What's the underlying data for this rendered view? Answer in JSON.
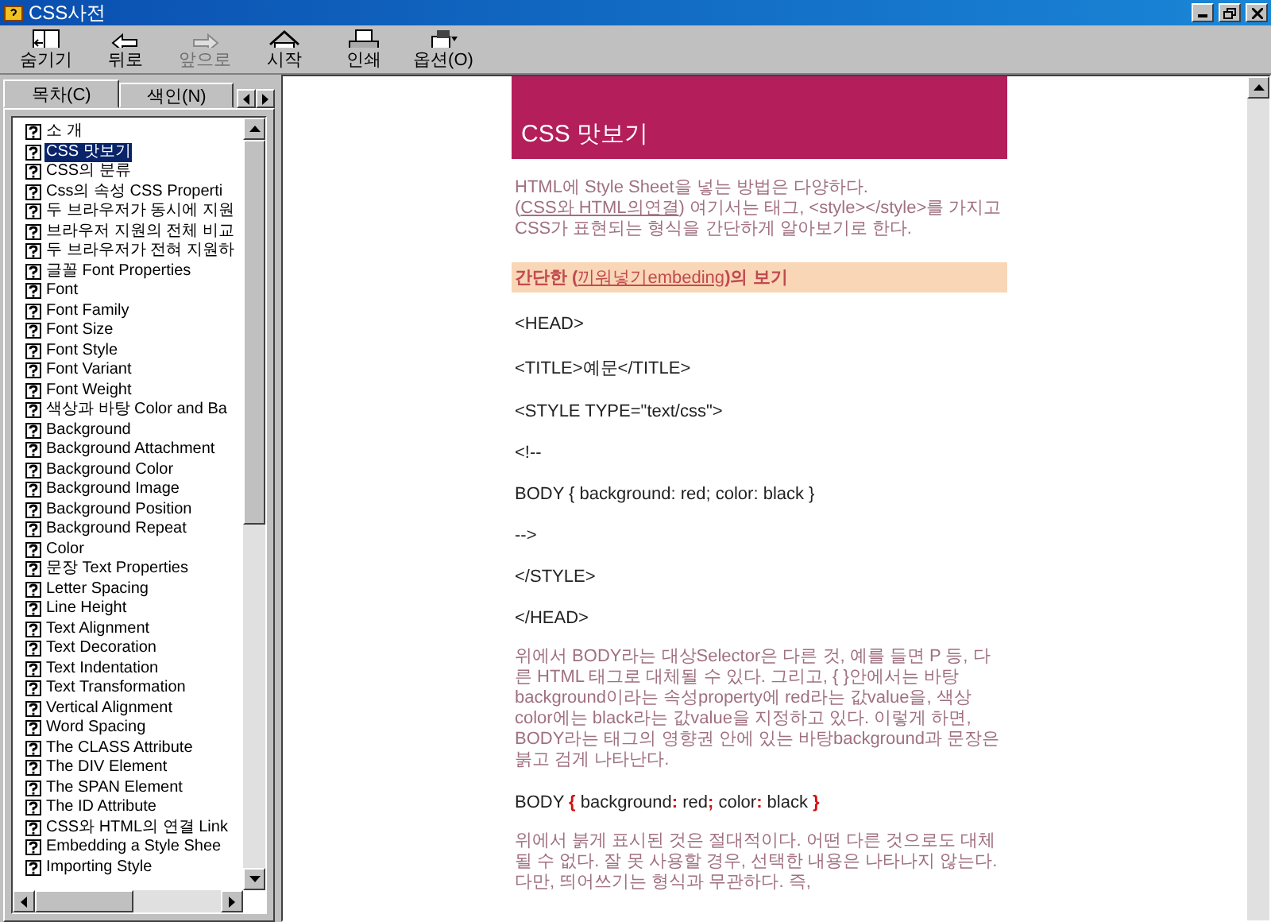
{
  "window": {
    "title": "CSS사전"
  },
  "toolbar": [
    {
      "label": "숨기기",
      "kind": "hide",
      "disabled": false
    },
    {
      "label": "뒤로",
      "kind": "back",
      "disabled": false
    },
    {
      "label": "앞으로",
      "kind": "forward",
      "disabled": true
    },
    {
      "label": "시작",
      "kind": "home",
      "disabled": false
    },
    {
      "label": "인쇄",
      "kind": "print",
      "disabled": false
    },
    {
      "label": "옵션(O)",
      "kind": "options",
      "disabled": false
    }
  ],
  "tabs": [
    {
      "label": "목차(C)",
      "selected": true
    },
    {
      "label": "색인(N)",
      "selected": false
    }
  ],
  "contents": [
    {
      "label": "소 개",
      "selected": false
    },
    {
      "label": "CSS 맛보기",
      "selected": true
    },
    {
      "label": "CSS의 분류",
      "selected": false
    },
    {
      "label": "Css의 속성 CSS Properti",
      "selected": false
    },
    {
      "label": "두 브라우저가 동시에 지원",
      "selected": false
    },
    {
      "label": "브라우저 지원의 전체 비교",
      "selected": false
    },
    {
      "label": "두 브라우저가 전혀 지원하",
      "selected": false
    },
    {
      "label": "글꼴 Font Properties",
      "selected": false
    },
    {
      "label": "Font",
      "selected": false
    },
    {
      "label": "Font Family",
      "selected": false
    },
    {
      "label": "Font Size",
      "selected": false
    },
    {
      "label": "Font Style",
      "selected": false
    },
    {
      "label": "Font Variant",
      "selected": false
    },
    {
      "label": "Font Weight",
      "selected": false
    },
    {
      "label": "색상과 바탕 Color and Ba",
      "selected": false
    },
    {
      "label": "Background",
      "selected": false
    },
    {
      "label": "Background Attachment",
      "selected": false
    },
    {
      "label": "Background Color",
      "selected": false
    },
    {
      "label": "Background Image",
      "selected": false
    },
    {
      "label": "Background Position",
      "selected": false
    },
    {
      "label": "Background Repeat",
      "selected": false
    },
    {
      "label": "Color",
      "selected": false
    },
    {
      "label": "문장 Text Properties",
      "selected": false
    },
    {
      "label": "Letter Spacing",
      "selected": false
    },
    {
      "label": "Line Height",
      "selected": false
    },
    {
      "label": "Text Alignment",
      "selected": false
    },
    {
      "label": "Text Decoration",
      "selected": false
    },
    {
      "label": "Text Indentation",
      "selected": false
    },
    {
      "label": "Text Transformation",
      "selected": false
    },
    {
      "label": "Vertical Alignment",
      "selected": false
    },
    {
      "label": "Word Spacing",
      "selected": false
    },
    {
      "label": "The CLASS Attribute",
      "selected": false
    },
    {
      "label": "The DIV Element",
      "selected": false
    },
    {
      "label": "The SPAN Element",
      "selected": false
    },
    {
      "label": "The ID Attribute",
      "selected": false
    },
    {
      "label": "CSS와 HTML의 연결 Link",
      "selected": false
    },
    {
      "label": "Embedding a Style Shee",
      "selected": false
    },
    {
      "label": "Importing Style",
      "selected": false
    }
  ],
  "page": {
    "title": "CSS 맛보기",
    "blocks": [
      {
        "kind": "prose",
        "parts": [
          {
            "text": "HTML에 Style Sheet을 넣는 방법은 다양하다.(",
            "link": false
          },
          {
            "text": "CSS와 HTML의연결",
            "link": true
          },
          {
            "text": ") 여기서는 태그, <style></style>를 가지고 CSS가 표현되는 형식을 간단하게 알아보기로 한다.",
            "link": false
          }
        ]
      },
      {
        "kind": "heading",
        "parts": [
          {
            "text": "간단한 (",
            "link": false
          },
          {
            "text": "끼워넣기embeding",
            "link": true
          },
          {
            "text": ")의 보기",
            "link": false
          }
        ]
      },
      {
        "kind": "code",
        "parts": [
          {
            "text": "<HEAD>",
            "accent": false
          }
        ]
      },
      {
        "kind": "code",
        "parts": [
          {
            "text": "<TITLE>예문</TITLE>",
            "accent": false
          }
        ]
      },
      {
        "kind": "code",
        "parts": [
          {
            "text": "<STYLE TYPE=\"text/css\">",
            "accent": false
          }
        ]
      },
      {
        "kind": "code",
        "parts": [
          {
            "text": "<!--",
            "accent": false
          }
        ]
      },
      {
        "kind": "code",
        "parts": [
          {
            "text": "BODY { background: red; color: black }",
            "accent": false
          }
        ]
      },
      {
        "kind": "code",
        "parts": [
          {
            "text": "-->",
            "accent": false
          }
        ]
      },
      {
        "kind": "code",
        "parts": [
          {
            "text": "</STYLE>",
            "accent": false
          }
        ]
      },
      {
        "kind": "code",
        "parts": [
          {
            "text": "</HEAD>",
            "accent": false
          }
        ]
      },
      {
        "kind": "prose",
        "parts": [
          {
            "text": "위에서 BODY라는 대상Selector은 다른 것, 예를 들면 P 등, 다른 HTML 태그로 대체될 수 있다. 그리고, { }안에서는 바탕 background이라는 속성property에 red라는 값value을, 색상color에는 black라는 값value을 지정하고 있다. 이렇게 하면, BODY라는 태그의 영향권 안에 있는 바탕background과 문장은 붉고 검게 나타난다.",
            "link": false
          }
        ]
      },
      {
        "kind": "code",
        "parts": [
          {
            "text": "BODY ",
            "accent": false
          },
          {
            "text": "{",
            "accent": true
          },
          {
            "text": " background",
            "accent": false
          },
          {
            "text": ":",
            "accent": true
          },
          {
            "text": " red",
            "accent": false
          },
          {
            "text": ";",
            "accent": true
          },
          {
            "text": " color",
            "accent": false
          },
          {
            "text": ":",
            "accent": true
          },
          {
            "text": " black ",
            "accent": false
          },
          {
            "text": "}",
            "accent": true
          }
        ]
      },
      {
        "kind": "prose",
        "parts": [
          {
            "text": "위에서 붉게 표시된 것은 절대적이다. 어떤 다른 것으로도 대체될 수 없다. 잘 못 사용할 경우, 선택한 내용은 나타나지 않는다. 다만, 띄어쓰기는 형식과 무관하다. 즉,",
            "link": false
          }
        ]
      }
    ]
  }
}
